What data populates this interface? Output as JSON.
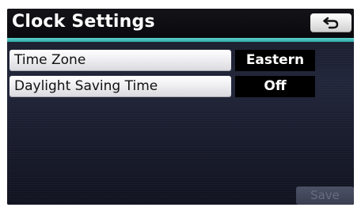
{
  "header": {
    "title": "Clock Settings",
    "back_icon": "return-arrow-icon"
  },
  "settings": {
    "rows": [
      {
        "label": "Time Zone",
        "value": "Eastern"
      },
      {
        "label": "Daylight Saving Time",
        "value": "Off"
      }
    ]
  },
  "footer": {
    "save_label": "Save",
    "save_enabled": false
  },
  "colors": {
    "accent_rule": "#2ea8a4",
    "background": "#1c1f30"
  }
}
